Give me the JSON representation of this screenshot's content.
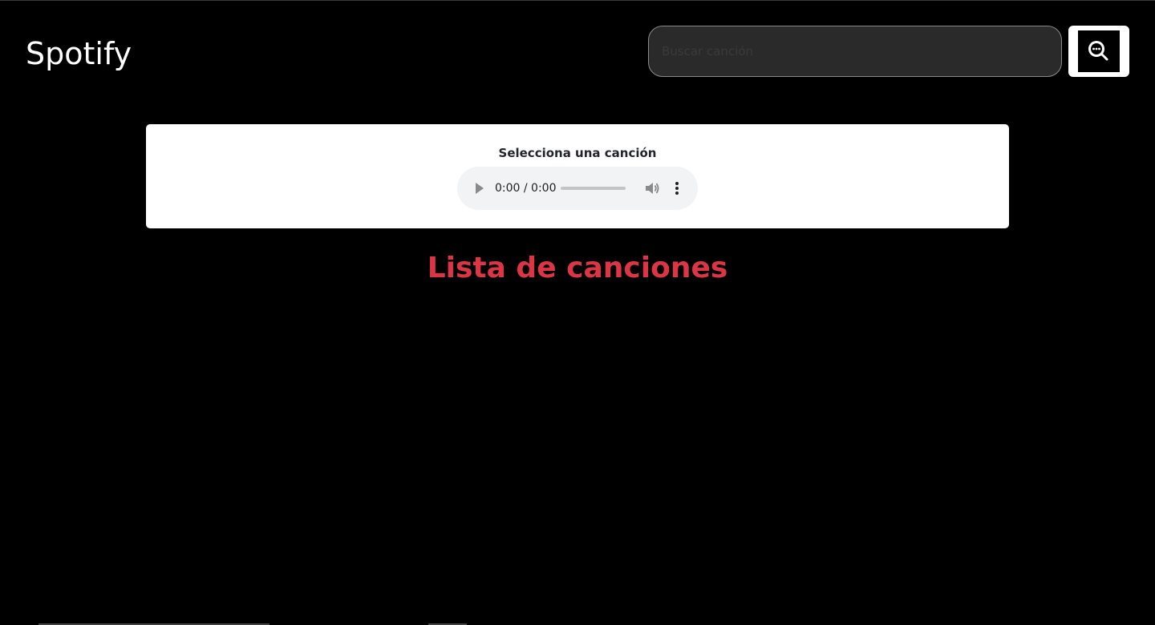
{
  "header": {
    "brand": "Spotify",
    "search": {
      "placeholder": "Buscar canción",
      "value": ""
    },
    "search_button_icon": "search-icon"
  },
  "player": {
    "title": "Selecciona una canción",
    "time": "0:00 / 0:00",
    "progress": 0,
    "icons": [
      "play-icon",
      "volume-icon",
      "more-options-icon"
    ]
  },
  "songs_section": {
    "title": "Lista de canciones",
    "items": []
  },
  "colors": {
    "background": "#000000",
    "accent": "#dc3545",
    "card": "#ffffff",
    "player_bg": "#f1f3f4"
  }
}
